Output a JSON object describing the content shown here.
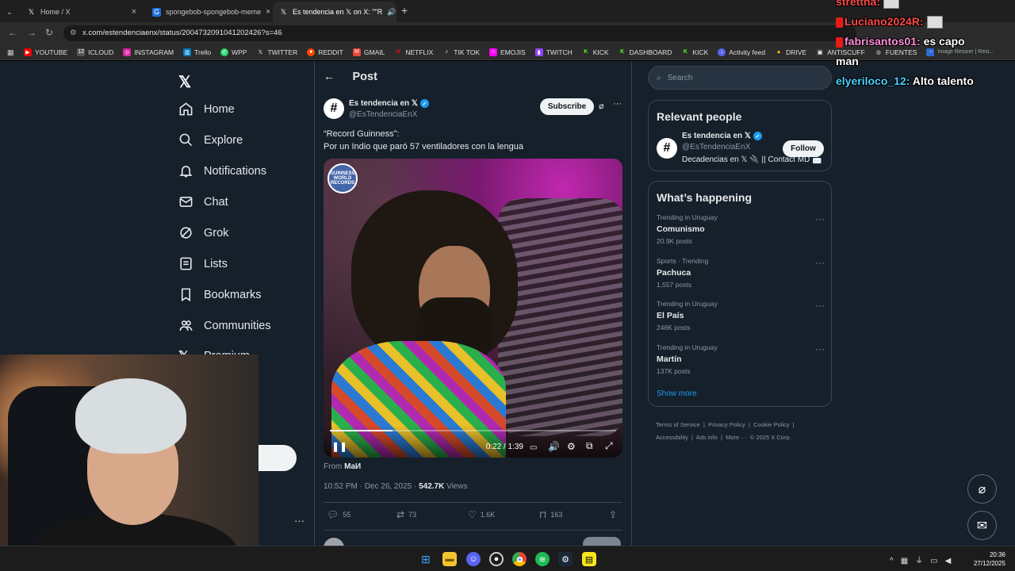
{
  "browser": {
    "tabs": [
      {
        "label": "Home / X",
        "active": false
      },
      {
        "label": "spongebob-spongebob-meme",
        "active": false
      },
      {
        "label": "Es tendencia en 𝕏 on X: \"\"R",
        "active": true
      }
    ],
    "url": "x.com/estendenciaenx/status/2004732091041202426?s=46",
    "bookmarks": [
      "YOUTUBE",
      "ICLOUD",
      "INSTAGRAM",
      "Trello",
      "WPP",
      "TWITTER",
      "REDDIT",
      "GMAIL",
      "NETFLIX",
      "TIK TOK",
      "EMOJIS",
      "TWITCH",
      "KICK",
      "DASHBOARD",
      "KICK",
      "Activity feed",
      "DRIVE",
      "ANTISCUFF",
      "FUENTES"
    ],
    "bookmark_extra": "Image Resizer | Resi..."
  },
  "nav": {
    "logo": "𝕏",
    "items": [
      {
        "label": "Home",
        "icon": "home-icon"
      },
      {
        "label": "Explore",
        "icon": "search-icon"
      },
      {
        "label": "Notifications",
        "icon": "bell-icon"
      },
      {
        "label": "Chat",
        "icon": "mail-icon"
      },
      {
        "label": "Grok",
        "icon": "grok-icon"
      },
      {
        "label": "Lists",
        "icon": "list-icon"
      },
      {
        "label": "Bookmarks",
        "icon": "bookmark-icon"
      },
      {
        "label": "Communities",
        "icon": "people-icon"
      },
      {
        "label": "Premium",
        "icon": "x-icon"
      }
    ]
  },
  "post": {
    "header": "Post",
    "author_name": "Es tendencia en 𝕏",
    "author_handle": "@EsTendenciaEnX",
    "subscribe_label": "Subscribe",
    "text_line1": "“Record Guinness”:",
    "text_line2": "Por un Indio que paró 57 ventiladores con la lengua",
    "video": {
      "badge_text": "GUINNESS WORLD RECORDS",
      "time": "0:22 / 1:39",
      "progress": 0.22
    },
    "from_label": "From",
    "from_name": "MaИ",
    "timestamp": "10:52 PM · Dec 26, 2025 · ",
    "views_count": "542.7K",
    "views_label": " Views",
    "stats": {
      "replies": "55",
      "reposts": "73",
      "likes": "1.6K",
      "bookmarks": "163"
    }
  },
  "right": {
    "search_placeholder": "Search",
    "relevant_title": "Relevant people",
    "person_name": "Es tendencia en 𝕏",
    "person_handle": "@EsTendenciaEnX",
    "person_bio": "Decadencias en 𝕏 🔌 || Contact MD 📩",
    "follow_label": "Follow",
    "happening_title": "What’s happening",
    "trends": [
      {
        "context": "Trending in Uruguay",
        "topic": "Comunismo",
        "count": "20.9K posts"
      },
      {
        "context": "Sports · Trending",
        "topic": "Pachuca",
        "count": "1,557 posts"
      },
      {
        "context": "Trending in Uruguay",
        "topic": "El País",
        "count": "246K posts"
      },
      {
        "context": "Trending in Uruguay",
        "topic": "Martín",
        "count": "137K posts"
      }
    ],
    "show_more": "Show more",
    "footer_line1": "Terms of Service  |  Privacy Policy  |  Cookie Policy  |",
    "footer_line2": "Accessibility  |  Ads info  |  More ···  © 2025 X Corp."
  },
  "chat": {
    "line0": "strettna:",
    "line1_user": "Luciano2024R:",
    "line2_user": "fabrisantos01:",
    "line2_msg": "es capo",
    "line2_cont": "man",
    "line3_user": "elyeriloco_12:",
    "line3_msg": "Alto talento"
  },
  "taskbar": {
    "time": "20:36",
    "date": "27/12/2025"
  }
}
